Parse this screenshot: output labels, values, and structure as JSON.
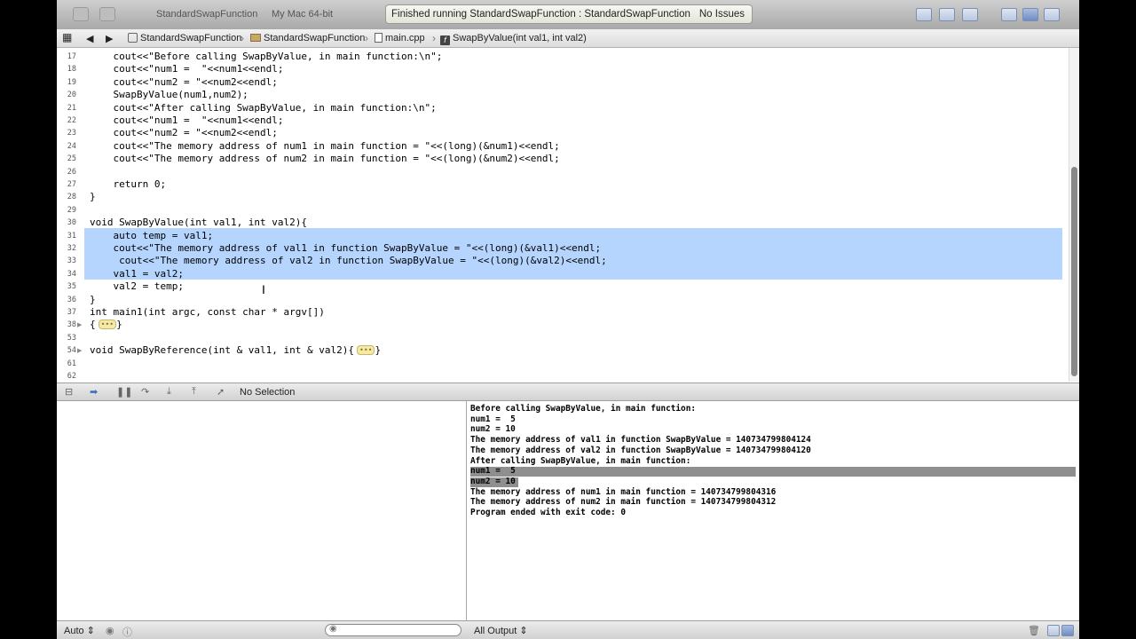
{
  "toolbar": {
    "scheme": "StandardSwapFunction",
    "destination": "My Mac 64-bit",
    "activity_message": "Finished running StandardSwapFunction : StandardSwapFunction",
    "issues": "No Issues"
  },
  "jumpbar": {
    "crumbs": [
      "StandardSwapFunction",
      "StandardSwapFunction",
      "main.cpp",
      "SwapByValue(int val1, int val2)"
    ]
  },
  "editor": {
    "lines": [
      {
        "n": "17",
        "t": "    cout<<\"Before calling SwapByValue, in main function:\\n\";"
      },
      {
        "n": "18",
        "t": "    cout<<\"num1 =  \"<<num1<<endl;"
      },
      {
        "n": "19",
        "t": "    cout<<\"num2 = \"<<num2<<endl;"
      },
      {
        "n": "20",
        "t": "    SwapByValue(num1,num2);"
      },
      {
        "n": "21",
        "t": "    cout<<\"After calling SwapByValue, in main function:\\n\";"
      },
      {
        "n": "22",
        "t": "    cout<<\"num1 =  \"<<num1<<endl;"
      },
      {
        "n": "23",
        "t": "    cout<<\"num2 = \"<<num2<<endl;"
      },
      {
        "n": "24",
        "t": "    cout<<\"The memory address of num1 in main function = \"<<(long)(&num1)<<endl;"
      },
      {
        "n": "25",
        "t": "    cout<<\"The memory address of num2 in main function = \"<<(long)(&num2)<<endl;"
      },
      {
        "n": "26",
        "t": ""
      },
      {
        "n": "27",
        "t": "    return 0;"
      },
      {
        "n": "28",
        "t": "}"
      },
      {
        "n": "29",
        "t": ""
      },
      {
        "n": "30",
        "t": "void SwapByValue(int val1, int val2){"
      },
      {
        "n": "31",
        "t": "    auto temp = val1;"
      },
      {
        "n": "32",
        "t": "    cout<<\"The memory address of val1 in function SwapByValue = \"<<(long)(&val1)<<endl;"
      },
      {
        "n": "33",
        "t": "     cout<<\"The memory address of val2 in function SwapByValue = \"<<(long)(&val2)<<endl;"
      },
      {
        "n": "34",
        "t": "    val1 = val2;"
      },
      {
        "n": "35",
        "t": "    val2 = temp;"
      },
      {
        "n": "36",
        "t": "}"
      },
      {
        "n": "37",
        "t": "int main1(int argc, const char * argv[])"
      },
      {
        "n": "38",
        "t": "{"
      },
      {
        "n": "53",
        "t": ""
      },
      {
        "n": "54",
        "t": "void SwapByReference(int & val1, int & val2){"
      },
      {
        "n": "61",
        "t": ""
      },
      {
        "n": "62",
        "t": ""
      }
    ],
    "fold_placeholder": "•••"
  },
  "debugbar": {
    "selection": "No Selection"
  },
  "console": {
    "lines": [
      "Before calling SwapByValue, in main function:",
      "num1 =  5",
      "num2 = 10",
      "The memory address of val1 in function SwapByValue = 140734799804124",
      "The memory address of val2 in function SwapByValue = 140734799804120",
      "After calling SwapByValue, in main function:",
      "num1 =  5",
      "num2 = 10",
      "The memory address of num1 in main function = 140734799804316",
      "The memory address of num2 in main function = 140734799804312",
      "Program ended with exit code: 0"
    ]
  },
  "bottombar": {
    "variables_mode": "Auto ⇕",
    "output_mode": "All Output ⇕"
  },
  "icons": {
    "run": "run-icon",
    "stop": "stop-icon",
    "breakpoint": "breakpoint-icon",
    "trash": "trash-icon"
  }
}
